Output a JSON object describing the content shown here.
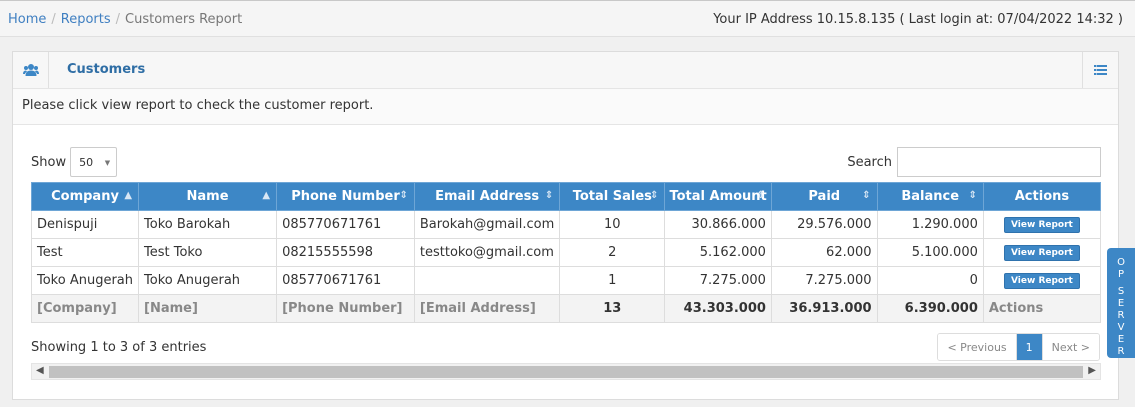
{
  "breadcrumb": {
    "items": [
      {
        "label": "Home"
      },
      {
        "label": "Reports"
      }
    ],
    "current": "Customers Report",
    "separator": "/"
  },
  "ip_info": "Your IP Address 10.15.8.135 ( Last login at: 07/04/2022 14:32 )",
  "portlet": {
    "title": "Customers",
    "notice": "Please click view report to check the customer report."
  },
  "controls": {
    "show_label": "Show",
    "page_length": "50",
    "search_label": "Search",
    "search_value": ""
  },
  "table": {
    "columns": [
      "Company",
      "Name",
      "Phone Number",
      "Email Address",
      "Total Sales",
      "Total Amount",
      "Paid",
      "Balance",
      "Actions"
    ],
    "rows": [
      {
        "company": "Denispuji",
        "name": "Toko Barokah",
        "phone": "085770671761",
        "email": "Barokah@gmail.com",
        "total_sales": "10",
        "total_amount": "30.866.000",
        "paid": "29.576.000",
        "balance": "1.290.000",
        "action": "View Report"
      },
      {
        "company": "Test",
        "name": "Test Toko",
        "phone": "08215555598",
        "email": "testtoko@gmail.com",
        "total_sales": "2",
        "total_amount": "5.162.000",
        "paid": "62.000",
        "balance": "5.100.000",
        "action": "View Report"
      },
      {
        "company": "Toko Anugerah",
        "name": "Toko Anugerah",
        "phone": "085770671761",
        "email": "",
        "total_sales": "1",
        "total_amount": "7.275.000",
        "paid": "7.275.000",
        "balance": "0",
        "action": "View Report"
      }
    ],
    "footer": {
      "company": "[Company]",
      "name": "[Name]",
      "phone": "[Phone Number]",
      "email": "[Email Address]",
      "total_sales": "13",
      "total_amount": "43.303.000",
      "paid": "36.913.000",
      "balance": "6.390.000",
      "actions": "Actions"
    }
  },
  "info": "Showing 1 to 3 of 3 entries",
  "pagination": {
    "previous": "< Previous",
    "current": "1",
    "next": "Next >"
  },
  "side_tab": {
    "letters": [
      "O",
      "P",
      "",
      "S",
      "E",
      "R",
      "V",
      "E",
      "R"
    ]
  },
  "colors": {
    "accent": "#3d87c6",
    "link": "#3f7fc1",
    "title": "#2f6ea5"
  },
  "icons": {
    "portlet": "users-icon",
    "menu": "list-icon"
  }
}
